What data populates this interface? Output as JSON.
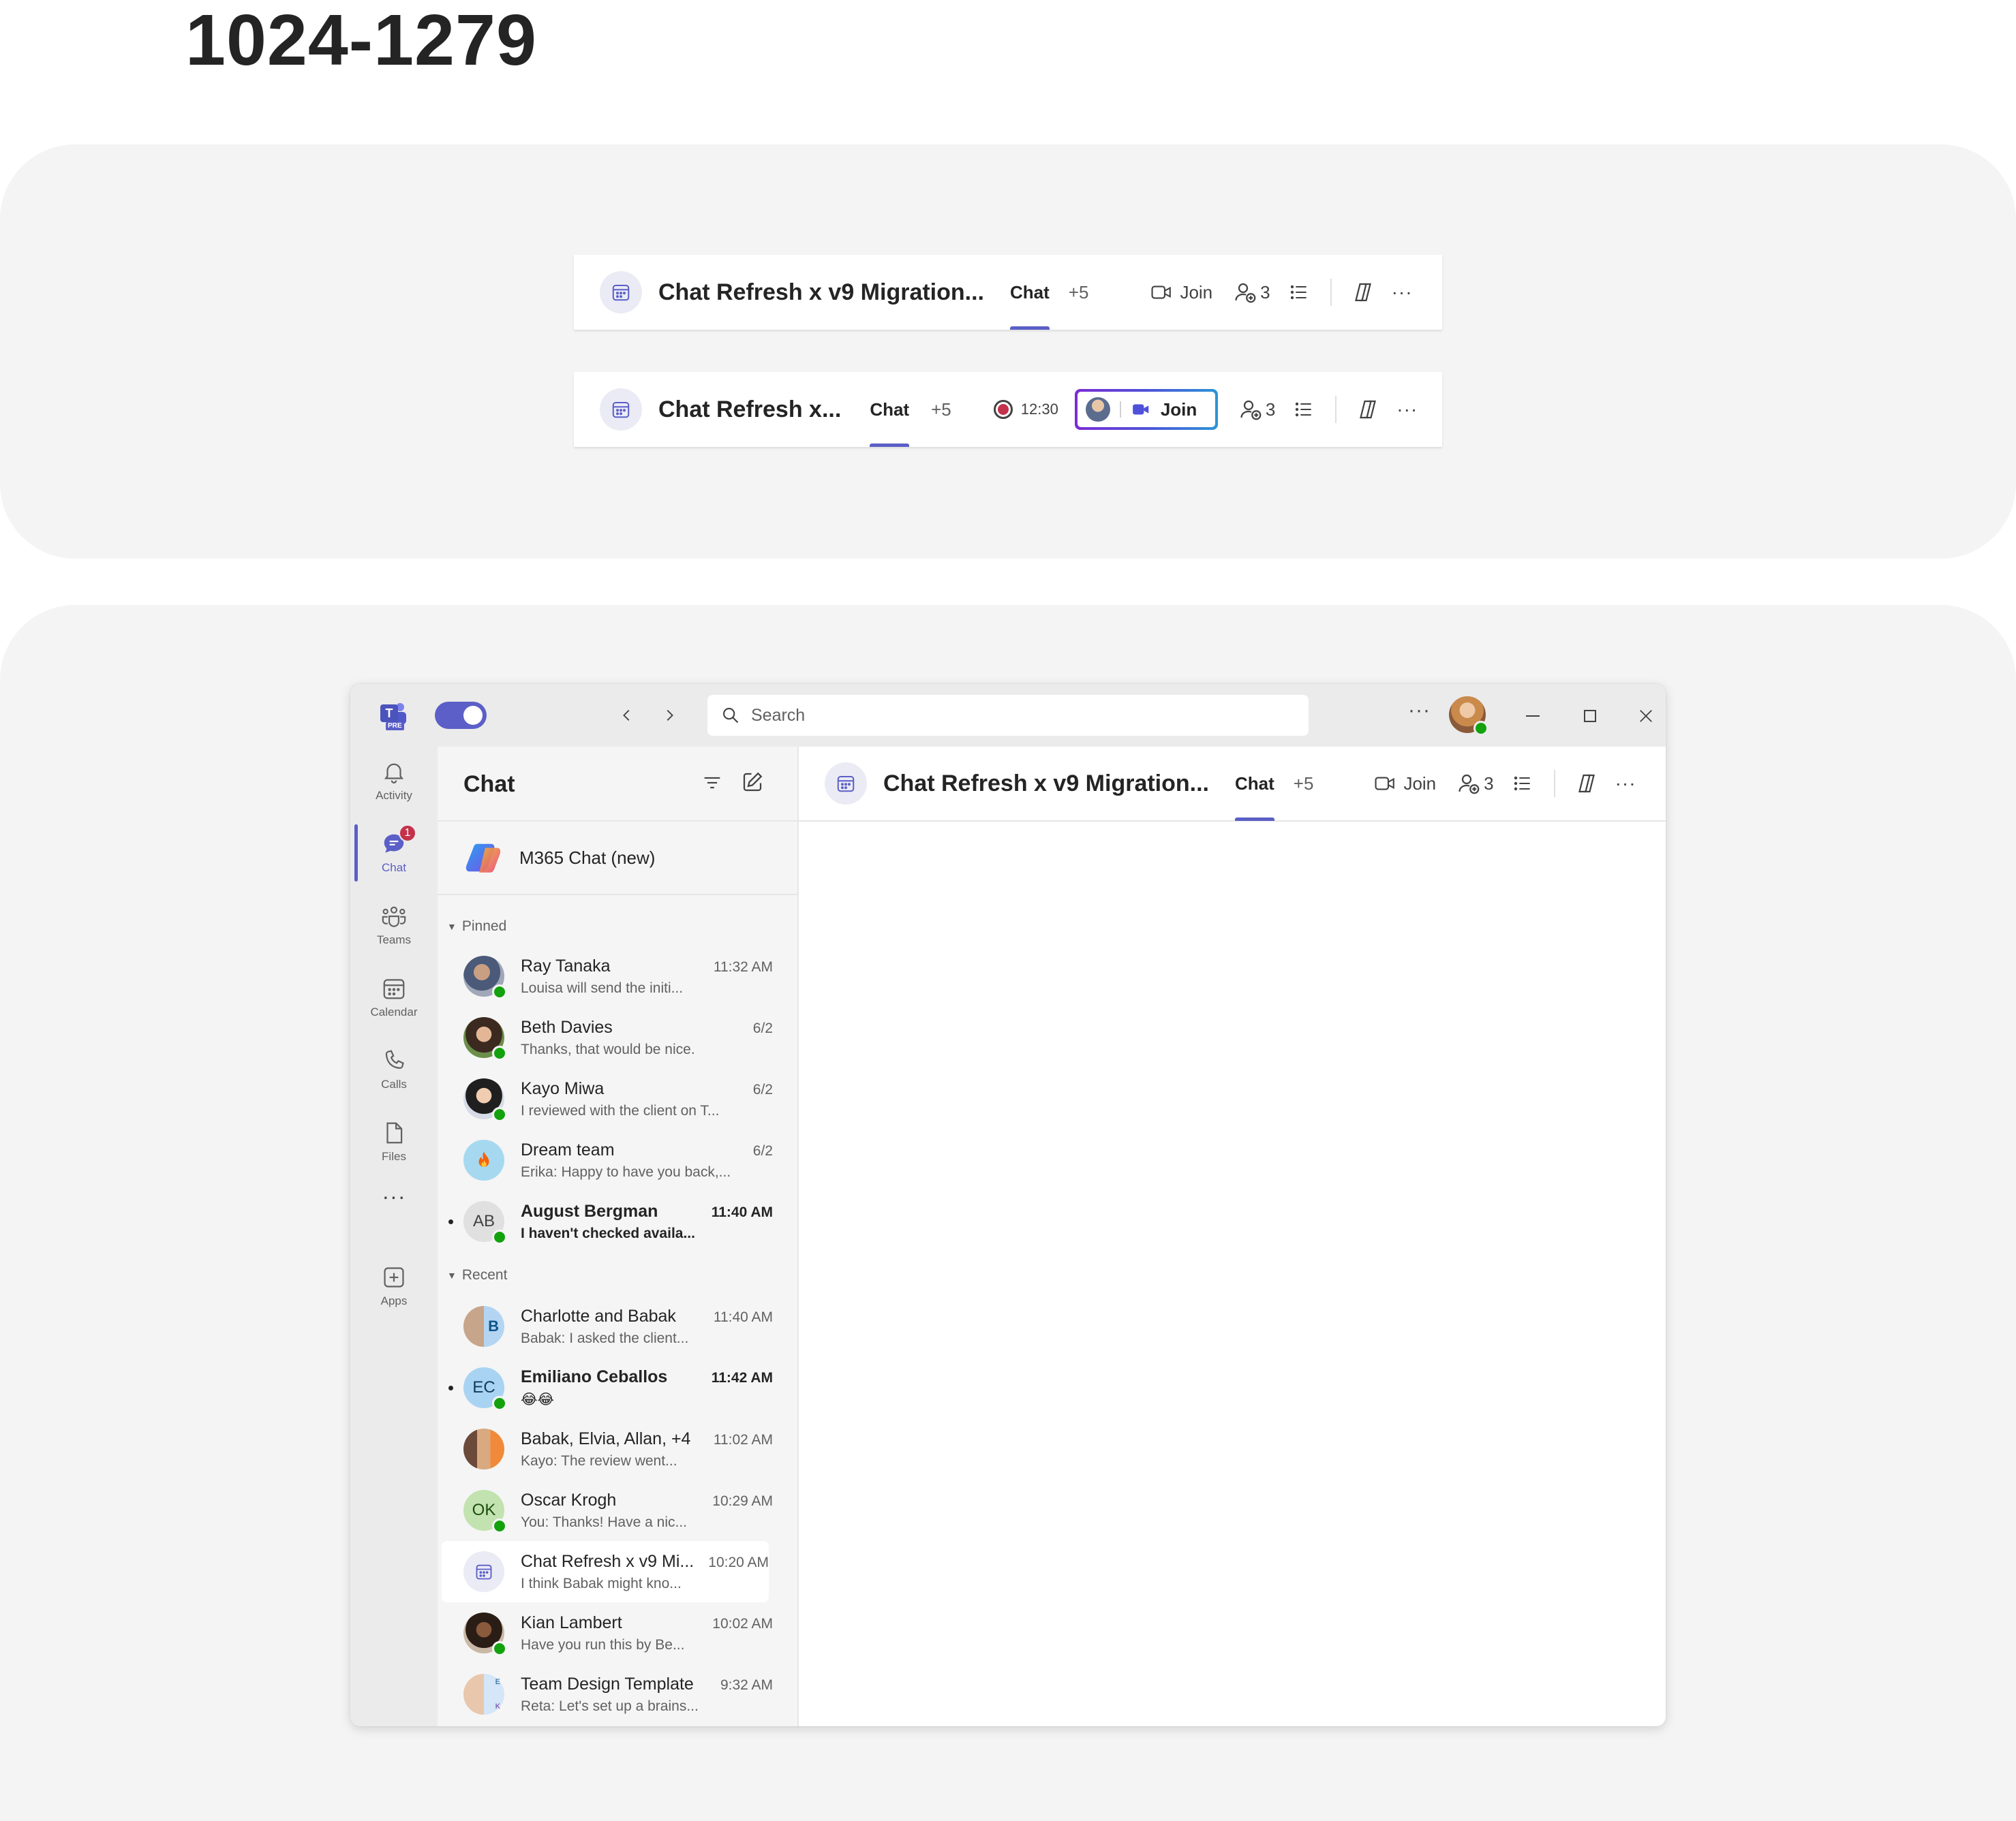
{
  "page_heading": "1024-1279",
  "header_a": {
    "title": "Chat Refresh x v9 Migration...",
    "tab": "Chat",
    "more_tabs": "+5",
    "join_label": "Join",
    "participants_count": "3"
  },
  "header_b": {
    "title": "Chat Refresh x...",
    "tab": "Chat",
    "more_tabs": "+5",
    "rec_time": "12:30",
    "join_label": "Join",
    "participants_count": "3"
  },
  "titlebar": {
    "app_badge": "PRE",
    "search_placeholder": "Search"
  },
  "rail": {
    "items": [
      {
        "label": "Activity",
        "icon": "bell-icon"
      },
      {
        "label": "Chat",
        "icon": "chat-icon",
        "badge": "1"
      },
      {
        "label": "Teams",
        "icon": "teams-icon"
      },
      {
        "label": "Calendar",
        "icon": "calendar-icon"
      },
      {
        "label": "Calls",
        "icon": "phone-icon"
      },
      {
        "label": "Files",
        "icon": "file-icon"
      },
      {
        "label": "Apps",
        "icon": "add-app-icon"
      }
    ]
  },
  "chatlist": {
    "title": "Chat",
    "copilot_label": "M365 Chat (new)",
    "pinned_label": "Pinned",
    "recent_label": "Recent",
    "pinned": [
      {
        "name": "Ray Tanaka",
        "time": "11:32 AM",
        "preview": "Louisa will send the initi..."
      },
      {
        "name": "Beth Davies",
        "time": "6/2",
        "preview": "Thanks, that would be nice."
      },
      {
        "name": "Kayo Miwa",
        "time": "6/2",
        "preview": "I reviewed with the client on T..."
      },
      {
        "name": "Dream team",
        "time": "6/2",
        "preview": "Erika: Happy to have you back,..."
      },
      {
        "name": "August Bergman",
        "time": "11:40 AM",
        "preview": "I haven't checked availa...",
        "initials": "AB"
      }
    ],
    "recent": [
      {
        "name": "Charlotte and Babak",
        "time": "11:40 AM",
        "preview": "Babak: I asked the client..."
      },
      {
        "name": "Emiliano Ceballos",
        "time": "11:42 AM",
        "preview": "😂😂",
        "initials": "EC"
      },
      {
        "name": "Babak, Elvia, Allan, +4",
        "time": "11:02 AM",
        "preview": "Kayo: The review went..."
      },
      {
        "name": "Oscar Krogh",
        "time": "10:29 AM",
        "preview": "You: Thanks! Have a nic...",
        "initials": "OK"
      },
      {
        "name": "Chat Refresh x v9 Mi...",
        "time": "10:20 AM",
        "preview": "I think Babak might kno..."
      },
      {
        "name": "Kian Lambert",
        "time": "10:02 AM",
        "preview": "Have you run this by Be..."
      },
      {
        "name": "Team Design Template",
        "time": "9:32 AM",
        "preview": "Reta: Let's set up a brains..."
      }
    ]
  },
  "main_header": {
    "title": "Chat Refresh x v9 Migration...",
    "tab": "Chat",
    "more_tabs": "+5",
    "join_label": "Join",
    "participants_count": "3"
  },
  "colors": {
    "brand": "#5b5fc7",
    "presence_available": "#13a10e",
    "notification_badge": "#c4314b"
  }
}
